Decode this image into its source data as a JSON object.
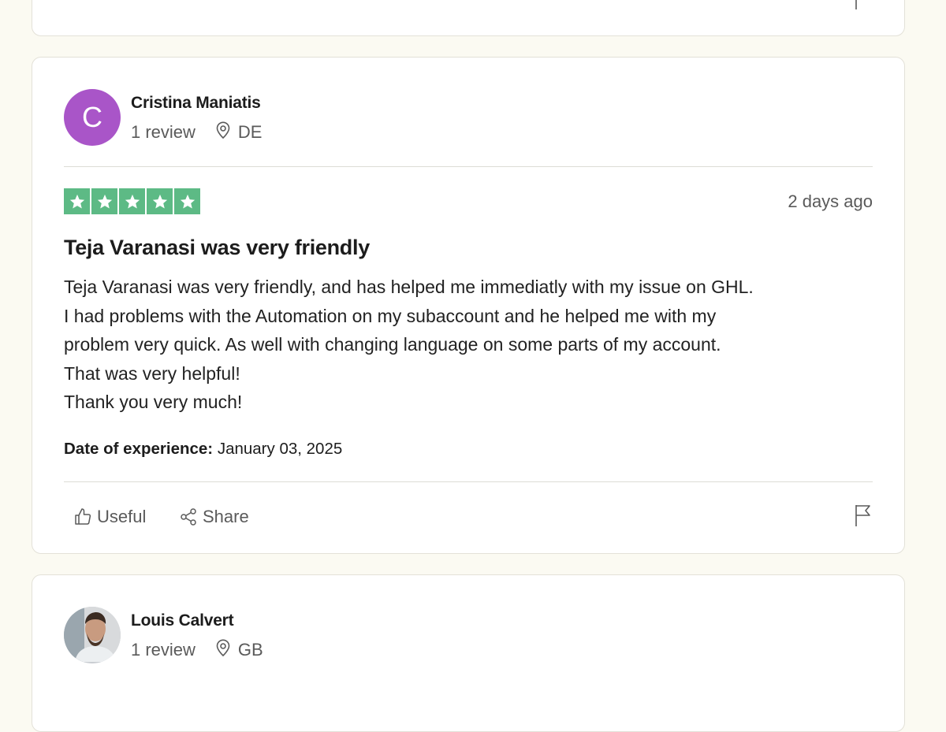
{
  "colors": {
    "page_background": "#fbfaf2",
    "card_background": "#ffffff",
    "star_green": "#5dba85",
    "avatar_purple": "#a955c8"
  },
  "actions": {
    "useful_label": "Useful",
    "share_label": "Share"
  },
  "reviews": [
    {
      "reviewer_name": "Cristina Maniatis",
      "avatar_letter": "C",
      "review_count": "1 review",
      "country": "DE",
      "rating": 5,
      "posted": "2 days ago",
      "title": "Teja Varanasi was very friendly",
      "body_lines": [
        "Teja Varanasi was very friendly, and has helped me immediatly with my issue on GHL.",
        "I had problems with the Automation on my subaccount and he helped me with my",
        "problem very quick. As well with changing language on some parts of my account.",
        "That was very helpful!",
        "Thank you very much!"
      ],
      "date_of_experience_label": "Date of experience:",
      "date_of_experience": "January 03, 2025"
    },
    {
      "reviewer_name": "Louis Calvert",
      "review_count": "1 review",
      "country": "GB"
    }
  ]
}
